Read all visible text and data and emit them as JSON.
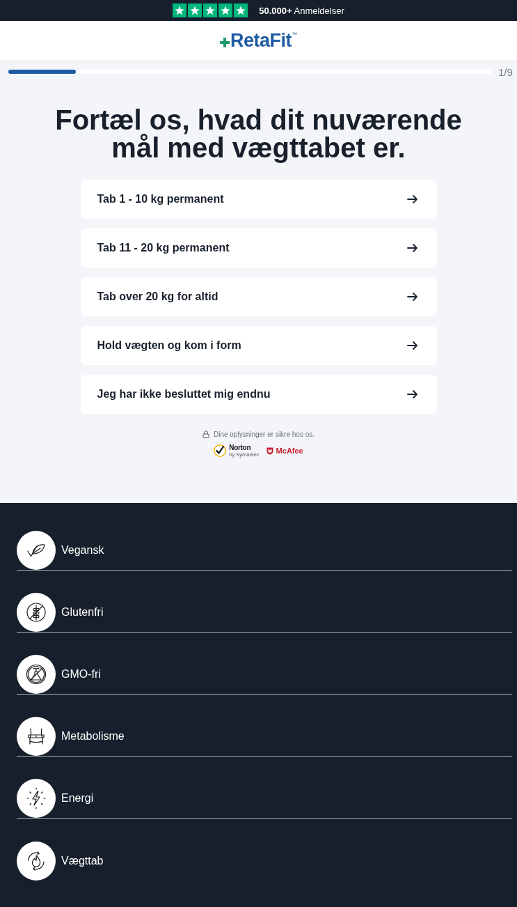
{
  "review_bar": {
    "stars": 5,
    "text": "**50.000+** Anmeldelser"
  },
  "logo": {
    "name": "RetaFit",
    "trademark": "™"
  },
  "progress": {
    "level": 0.14,
    "step": "1/9"
  },
  "question": "Fortæl os, hvad dit nuværende mål med vægttabet er.",
  "options": [
    {
      "label": "Tab 1 - 10 kg permanent"
    },
    {
      "label": "Tab 11 - 20 kg permanent"
    },
    {
      "label": "Tab over 20 kg for altid"
    },
    {
      "label": "Hold vægten og kom i form"
    },
    {
      "label": "Jeg har ikke besluttet mig endnu"
    }
  ],
  "security_note": "Dine oplysninger er sikre hos os.",
  "trust_badges": [
    {
      "kind": "norton",
      "name": "Norton",
      "caption": "by Symantec"
    },
    {
      "kind": "mcafee",
      "name": "McAfee"
    }
  ],
  "features": [
    {
      "kind": "vegan",
      "label": "Vegansk"
    },
    {
      "kind": "gluten_free",
      "label": "Glutenfri"
    },
    {
      "kind": "gmo_free",
      "label": "GMO-fri"
    },
    {
      "kind": "metabolism",
      "label": "Metabolisme"
    },
    {
      "kind": "energy",
      "label": "Energi"
    },
    {
      "kind": "weight_loss",
      "label": "Vægttab"
    }
  ]
}
